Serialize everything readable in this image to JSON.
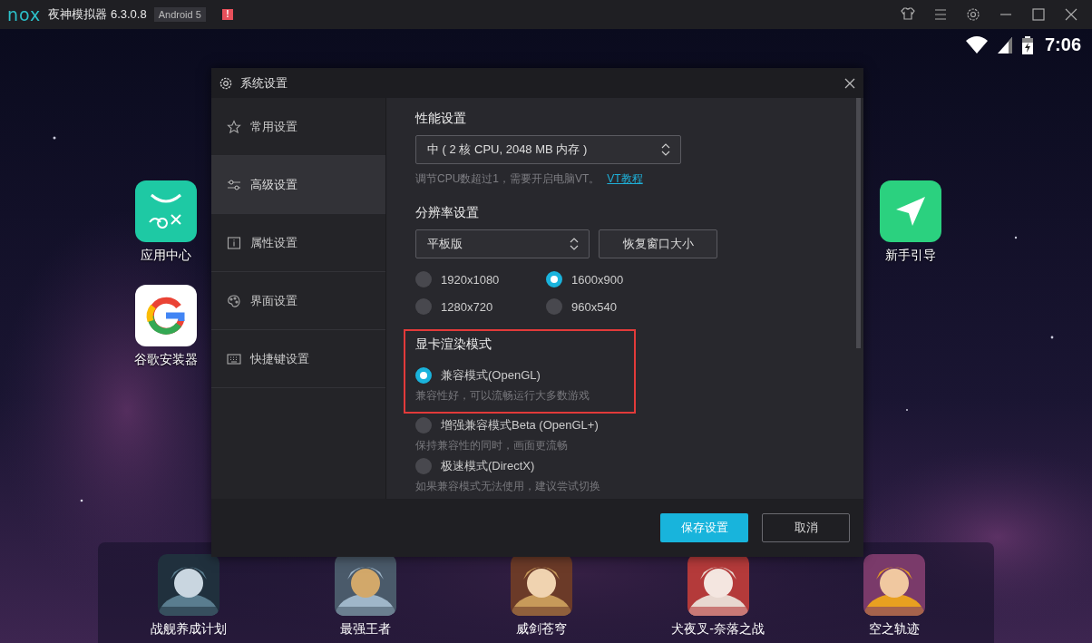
{
  "title_bar": {
    "logo": "nox",
    "title": "夜神模拟器 6.3.0.8",
    "version_badge": "Android 5",
    "alert_badge": "!"
  },
  "status_bar": {
    "time": "7:06"
  },
  "desktop_icons": [
    {
      "label": "应用中心"
    },
    {
      "label": "谷歌安装器"
    },
    {
      "label": "新手引导"
    }
  ],
  "dialog": {
    "title": "系统设置",
    "sidebar": [
      {
        "label": "常用设置",
        "selected": false
      },
      {
        "label": "高级设置",
        "selected": true
      },
      {
        "label": "属性设置",
        "selected": false
      },
      {
        "label": "界面设置",
        "selected": false
      },
      {
        "label": "快捷键设置",
        "selected": false
      }
    ],
    "performance": {
      "heading": "性能设置",
      "value": "中 ( 2 核 CPU, 2048 MB 内存 )",
      "hint": "调节CPU数超过1，需要开启电脑VT。",
      "link": "VT教程"
    },
    "resolution": {
      "heading": "分辨率设置",
      "value": "平板版",
      "reset_button": "恢复窗口大小",
      "options": [
        {
          "label": "1920x1080",
          "selected": false
        },
        {
          "label": "1600x900",
          "selected": true
        },
        {
          "label": "1280x720",
          "selected": false
        },
        {
          "label": "960x540",
          "selected": false
        }
      ]
    },
    "render": {
      "heading": "显卡渲染模式",
      "highlighted": true,
      "modes": [
        {
          "label": "兼容模式(OpenGL)",
          "description": "兼容性好，可以流畅运行大多数游戏",
          "selected": true
        },
        {
          "label": "增强兼容模式Beta (OpenGL+)",
          "description": "保持兼容性的同时，画面更流畅",
          "selected": false
        },
        {
          "label": "极速模式(DirectX)",
          "description": "如果兼容模式无法使用，建议尝试切换",
          "selected": false
        }
      ]
    },
    "buttons": [
      {
        "label": "保存设置",
        "kind": "primary"
      },
      {
        "label": "取消",
        "kind": "secondary"
      }
    ]
  },
  "dock": [
    {
      "label": "战舰养成计划",
      "kind": "picture"
    },
    {
      "label": "最强王者",
      "kind": "picture"
    },
    {
      "label": "威剑苍穹",
      "kind": "picture"
    },
    {
      "label": "犬夜叉-奈落之战",
      "kind": "picture"
    },
    {
      "label": "空之轨迹",
      "kind": "picture"
    }
  ]
}
